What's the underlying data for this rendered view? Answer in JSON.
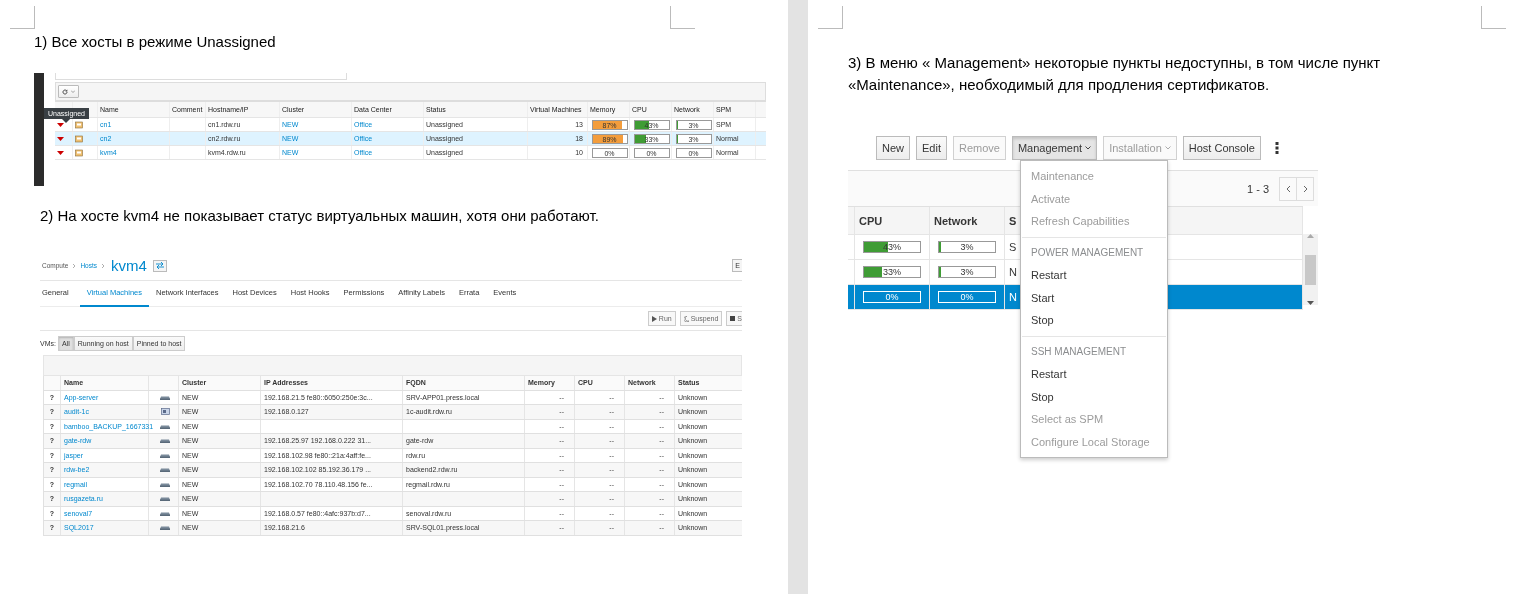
{
  "left_page": {
    "heading_1": "1) Все хосты в режиме Unassigned",
    "hosts_screenshot": {
      "tooltip": "Unassigned",
      "columns": [
        "Name",
        "Comment",
        "Hostname/IP",
        "Cluster",
        "Data Center",
        "Status",
        "Virtual Machines",
        "Memory",
        "CPU",
        "Network",
        "SPM"
      ],
      "rows": [
        {
          "name": "cn1",
          "hostname": "cn1.rdw.ru",
          "cluster": "NEW",
          "data_center": "Office",
          "status": "Unassigned",
          "vms": "13",
          "memory": {
            "level": 0.87,
            "text": "87%"
          },
          "cpu": {
            "level": 0.43,
            "text": "43%"
          },
          "network": {
            "level": 0.03,
            "text": "3%"
          },
          "spm": "SPM",
          "selected": false
        },
        {
          "name": "cn2",
          "hostname": "cn2.rdw.ru",
          "cluster": "NEW",
          "data_center": "Office",
          "status": "Unassigned",
          "vms": "18",
          "memory": {
            "level": 0.89,
            "text": "89%"
          },
          "cpu": {
            "level": 0.33,
            "text": "33%"
          },
          "network": {
            "level": 0.03,
            "text": "3%"
          },
          "spm": "Normal",
          "selected": true
        },
        {
          "name": "kvm4",
          "hostname": "kvm4.rdw.ru",
          "cluster": "NEW",
          "data_center": "Office",
          "status": "Unassigned",
          "vms": "10",
          "memory": {
            "level": 0,
            "text": "0%"
          },
          "cpu": {
            "level": 0,
            "text": "0%"
          },
          "network": {
            "level": 0,
            "text": "0%"
          },
          "spm": "Normal",
          "selected": false
        }
      ]
    },
    "heading_2": "2) На хосте kvm4 не показывает статус виртуальных машин, хотя они работают.",
    "vm_screenshot": {
      "breadcrumb": [
        "Compute",
        "Hosts"
      ],
      "title": "kvm4",
      "cut_button": "E",
      "tabs": [
        {
          "label": "General",
          "selected": false
        },
        {
          "label": "Virtual Machines",
          "selected": true
        },
        {
          "label": "Network Interfaces",
          "selected": false
        },
        {
          "label": "Host Devices",
          "selected": false
        },
        {
          "label": "Host Hooks",
          "selected": false
        },
        {
          "label": "Permissions",
          "selected": false
        },
        {
          "label": "Affinity Labels",
          "selected": false
        },
        {
          "label": "Errata",
          "selected": false
        },
        {
          "label": "Events",
          "selected": false
        }
      ],
      "actions": [
        {
          "kind": "run",
          "label": "Run"
        },
        {
          "kind": "suspend",
          "label": "Suspend"
        },
        {
          "kind": "stop",
          "label": "S"
        }
      ],
      "filter_label": "VMs:",
      "filters": [
        {
          "label": "All",
          "selected": true
        },
        {
          "label": "Running on host",
          "selected": false
        },
        {
          "label": "Pinned to host",
          "selected": false
        }
      ],
      "columns": [
        "Name",
        "Cluster",
        "IP Addresses",
        "FQDN",
        "Memory",
        "CPU",
        "Network",
        "Status"
      ],
      "rows": [
        {
          "mark": "?",
          "name": "App-server",
          "kind": "server",
          "cluster": "NEW",
          "ip": "192.168.21.5 fe80::6050:250e:3c...",
          "fqdn": "SRV-APP01.press.local",
          "memory": "--",
          "cpu": "--",
          "network": "--",
          "status": "Unknown"
        },
        {
          "mark": "?",
          "name": "audit-1c",
          "kind": "desktop",
          "cluster": "NEW",
          "ip": "192.168.0.127",
          "fqdn": "1c-audit.rdw.ru",
          "memory": "--",
          "cpu": "--",
          "network": "--",
          "status": "Unknown"
        },
        {
          "mark": "?",
          "name": "bamboo_BACKUP_1667331",
          "kind": "server",
          "cluster": "NEW",
          "memory": "--",
          "cpu": "--",
          "network": "--",
          "status": "Unknown"
        },
        {
          "mark": "?",
          "name": "gate-rdw",
          "kind": "server",
          "cluster": "NEW",
          "ip": "192.168.25.97 192.168.0.222 31...",
          "fqdn": "gate-rdw",
          "memory": "--",
          "cpu": "--",
          "network": "--",
          "status": "Unknown"
        },
        {
          "mark": "?",
          "name": "jasper",
          "kind": "server",
          "cluster": "NEW",
          "ip": "192.168.102.98 fe80::21a:4aff:fe...",
          "fqdn": "rdw.ru",
          "memory": "--",
          "cpu": "--",
          "network": "--",
          "status": "Unknown"
        },
        {
          "mark": "?",
          "name": "rdw-be2",
          "kind": "server",
          "cluster": "NEW",
          "ip": "192.168.102.102 85.192.36.179 ...",
          "fqdn": "backend2.rdw.ru",
          "memory": "--",
          "cpu": "--",
          "network": "--",
          "status": "Unknown"
        },
        {
          "mark": "?",
          "name": "regmail",
          "kind": "server",
          "cluster": "NEW",
          "ip": "192.168.102.70 78.110.48.156 fe...",
          "fqdn": "regmail.rdw.ru",
          "memory": "--",
          "cpu": "--",
          "network": "--",
          "status": "Unknown"
        },
        {
          "mark": "?",
          "name": "rusgazeta.ru",
          "kind": "server",
          "cluster": "NEW",
          "memory": "--",
          "cpu": "--",
          "network": "--",
          "status": "Unknown"
        },
        {
          "mark": "?",
          "name": "senoval7",
          "kind": "server",
          "cluster": "NEW",
          "ip": "192.168.0.57 fe80::4afc:937b:d7...",
          "fqdn": "senoval.rdw.ru",
          "memory": "--",
          "cpu": "--",
          "network": "--",
          "status": "Unknown"
        },
        {
          "mark": "?",
          "name": "SQL2017",
          "kind": "server",
          "cluster": "NEW",
          "ip": "192.168.21.6",
          "fqdn": "SRV-SQL01.press.local",
          "memory": "--",
          "cpu": "--",
          "network": "--",
          "status": "Unknown"
        }
      ]
    }
  },
  "right_page": {
    "heading_3": "3) В меню « Management» некоторые пункты недоступны, в том числе пункт «Maintenance», необходимый для продления сертификатов.",
    "menu_screenshot": {
      "buttons": [
        {
          "label": "New",
          "disabled": false,
          "dropdown": false,
          "open": false
        },
        {
          "label": "Edit",
          "disabled": false,
          "dropdown": false,
          "open": false
        },
        {
          "label": "Remove",
          "disabled": true,
          "dropdown": false,
          "open": false
        },
        {
          "label": "Management",
          "disabled": false,
          "dropdown": true,
          "open": true
        },
        {
          "label": "Installation",
          "disabled": true,
          "dropdown": true,
          "open": false
        },
        {
          "label": "Host Console",
          "disabled": false,
          "dropdown": false,
          "open": false
        }
      ],
      "pager": "1 - 3",
      "columns": [
        "CPU",
        "Network",
        "S"
      ],
      "rows": [
        {
          "cpu": {
            "level": 0.43,
            "text": "43%"
          },
          "network": {
            "level": 0.03,
            "text": "3%"
          },
          "status": "S",
          "selected": false
        },
        {
          "cpu": {
            "level": 0.33,
            "text": "33%"
          },
          "network": {
            "level": 0.03,
            "text": "3%"
          },
          "status": "N",
          "selected": false
        },
        {
          "cpu": {
            "level": 0,
            "text": "0%"
          },
          "network": {
            "level": 0,
            "text": "0%"
          },
          "status": "N",
          "selected": true
        }
      ],
      "menu": [
        {
          "items": [
            {
              "label": "Maintenance",
              "disabled": true
            },
            {
              "label": "Activate",
              "disabled": true
            },
            {
              "label": "Refresh Capabilities",
              "disabled": true
            }
          ]
        },
        {
          "header": "POWER MANAGEMENT",
          "items": [
            {
              "label": "Restart",
              "disabled": false
            },
            {
              "label": "Start",
              "disabled": false
            },
            {
              "label": "Stop",
              "disabled": false
            }
          ]
        },
        {
          "header": "SSH MANAGEMENT",
          "items": [
            {
              "label": "Restart",
              "disabled": false
            },
            {
              "label": "Stop",
              "disabled": false
            },
            {
              "label": "Select as SPM",
              "disabled": true
            },
            {
              "label": "Configure Local Storage",
              "disabled": true
            }
          ]
        }
      ]
    }
  }
}
